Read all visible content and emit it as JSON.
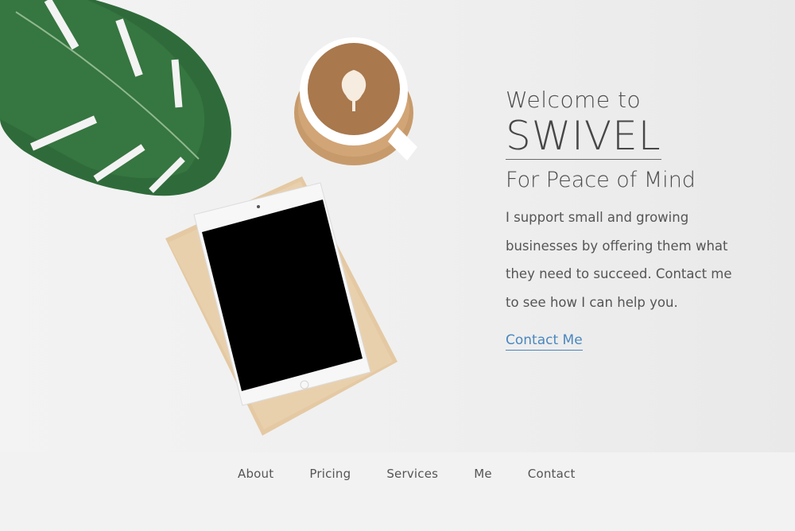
{
  "hero": {
    "welcome": "Welcome to",
    "brand": "SWIVEL",
    "tagline": "For Peace of Mind",
    "intro": "I support small and growing businesses by offering them what they need to succeed. Contact me to see how I can help you.",
    "cta_label": "Contact Me"
  },
  "nav": {
    "items": [
      {
        "label": "About"
      },
      {
        "label": "Pricing"
      },
      {
        "label": "Services"
      },
      {
        "label": "Me"
      },
      {
        "label": "Contact"
      }
    ]
  },
  "colors": {
    "accent": "#4a87bf",
    "text": "#4a4a4a",
    "background": "#f2f2f2"
  }
}
